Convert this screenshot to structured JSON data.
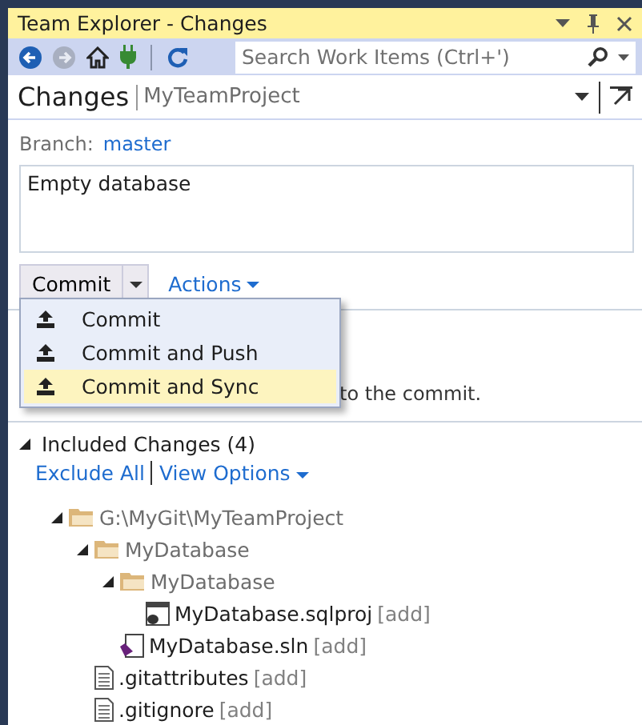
{
  "window": {
    "title": "Team Explorer - Changes"
  },
  "toolbar": {
    "search": {
      "placeholder": "Search Work Items (Ctrl+')"
    }
  },
  "header": {
    "title": "Changes",
    "project": "MyTeamProject"
  },
  "branch": {
    "label": "Branch:",
    "name": "master"
  },
  "commit_message": "Empty database",
  "commit_button": "Commit",
  "actions_link": "Actions",
  "commit_menu": [
    {
      "label": "Commit",
      "selected": false
    },
    {
      "label": "Commit and Push",
      "selected": false
    },
    {
      "label": "Commit and Sync",
      "selected": true
    }
  ],
  "hidden_note": "to the commit.",
  "included": {
    "title": "Included Changes (4)",
    "links": [
      "Exclude All",
      "View Options"
    ],
    "tree": [
      {
        "kind": "folder",
        "name": "G:\\MyGit\\MyTeamProject",
        "expanded": true,
        "children": [
          {
            "kind": "folder",
            "name": "MyDatabase",
            "expanded": true,
            "children": [
              {
                "kind": "folder",
                "name": "MyDatabase",
                "expanded": true,
                "children": [
                  {
                    "kind": "sqlproj",
                    "name": "MyDatabase.sqlproj",
                    "status": "[add]"
                  }
                ]
              },
              {
                "kind": "sln",
                "name": "MyDatabase.sln",
                "status": "[add]"
              }
            ]
          },
          {
            "kind": "file",
            "name": ".gitattributes",
            "status": "[add]"
          },
          {
            "kind": "file",
            "name": ".gitignore",
            "status": "[add]"
          }
        ]
      }
    ]
  }
}
